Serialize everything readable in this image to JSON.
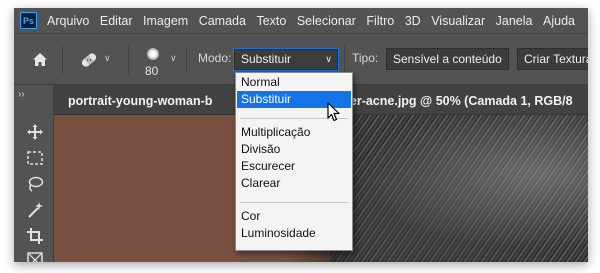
{
  "menubar": {
    "logo": "Ps",
    "items": [
      "Arquivo",
      "Editar",
      "Imagem",
      "Camada",
      "Texto",
      "Selecionar",
      "Filtro",
      "3D",
      "Visualizar",
      "Janela",
      "Ajuda"
    ]
  },
  "options": {
    "home_icon": "home-icon",
    "tool_icon": "bandage-brush-icon",
    "brush_size": "80",
    "mode_label": "Modo:",
    "mode_value": "Substituir",
    "type_label": "Tipo:",
    "type_buttons": [
      "Sensível a conteúdo",
      "Criar Textura"
    ]
  },
  "document": {
    "tab_title": "portrait-young-woman-b",
    "tab_title_suffix": "n-her-acne.jpg @ 50% (Camada 1, RGB/8"
  },
  "toolbar": {
    "expand": "››",
    "tools": [
      "move-tool-icon",
      "marquee-tool-icon",
      "lasso-tool-icon",
      "magic-wand-icon",
      "crop-tool-icon",
      "frame-tool-icon"
    ]
  },
  "blend_dropdown": {
    "groups": [
      [
        "Normal",
        "Substituir"
      ],
      [
        "Multiplicação",
        "Divisão",
        "Escurecer",
        "Clarear"
      ],
      [
        "Cor",
        "Luminosidade"
      ]
    ],
    "selected": "Substituir"
  },
  "colors": {
    "panel_bg": "#535353",
    "accent": "#1473e6",
    "canvas_fill": "#7a5140"
  }
}
